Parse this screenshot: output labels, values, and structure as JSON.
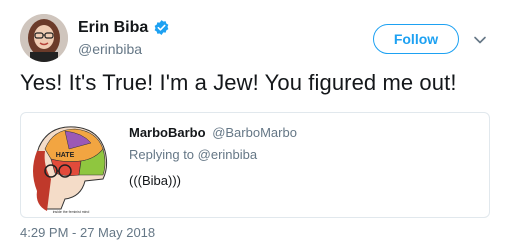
{
  "author": {
    "display_name": "Erin Biba",
    "handle": "@erinbiba",
    "verified": true
  },
  "follow_button": {
    "label": "Follow"
  },
  "tweet": {
    "text": "Yes! It's True! I'm a Jew! You figured me out!",
    "timestamp": "4:29 PM - 27 May 2018"
  },
  "quoted_tweet": {
    "display_name": "MarboBarbo",
    "handle": "@BarboMarbo",
    "replying_to_prefix": "Replying to ",
    "replying_to_handle": "@erinbiba",
    "text": "(((Biba)))",
    "media": {
      "hate_label": "HATE",
      "caption": "inside the feminist mind"
    }
  },
  "colors": {
    "accent": "#1da1f2",
    "secondary_text": "#657786",
    "primary_text": "#14171a",
    "border": "#e1e8ed"
  },
  "icons": {
    "verified": "verified-badge-icon",
    "menu": "chevron-down-icon"
  }
}
